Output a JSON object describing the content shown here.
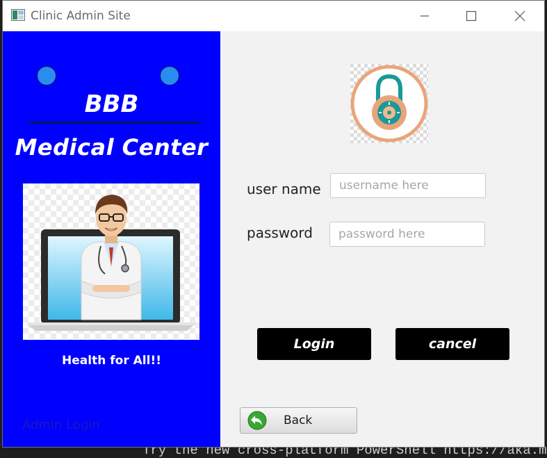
{
  "window": {
    "title": "Clinic Admin Site",
    "controls": {
      "minimize": "minimize-icon",
      "maximize": "maximize-icon",
      "close": "close-icon"
    }
  },
  "console": {
    "text": "Try the new cross-platform PowerShell https://aka.ms/"
  },
  "sidebar": {
    "brand": "BBB",
    "subtitle": "Medical Center",
    "tagline": "Health for All!!",
    "footer_label": "Admin Login",
    "image": "doctor-laptop-illustration",
    "background_color": "#0000ff"
  },
  "login_form": {
    "icon": "padlock-icon",
    "username_label": "user name",
    "username_placeholder": "username here",
    "username_value": "",
    "password_label": "password",
    "password_placeholder": "password here",
    "password_value": "",
    "login_label": "Login",
    "cancel_label": "cancel",
    "back_label": "Back",
    "back_icon": "back-arrow-icon"
  }
}
